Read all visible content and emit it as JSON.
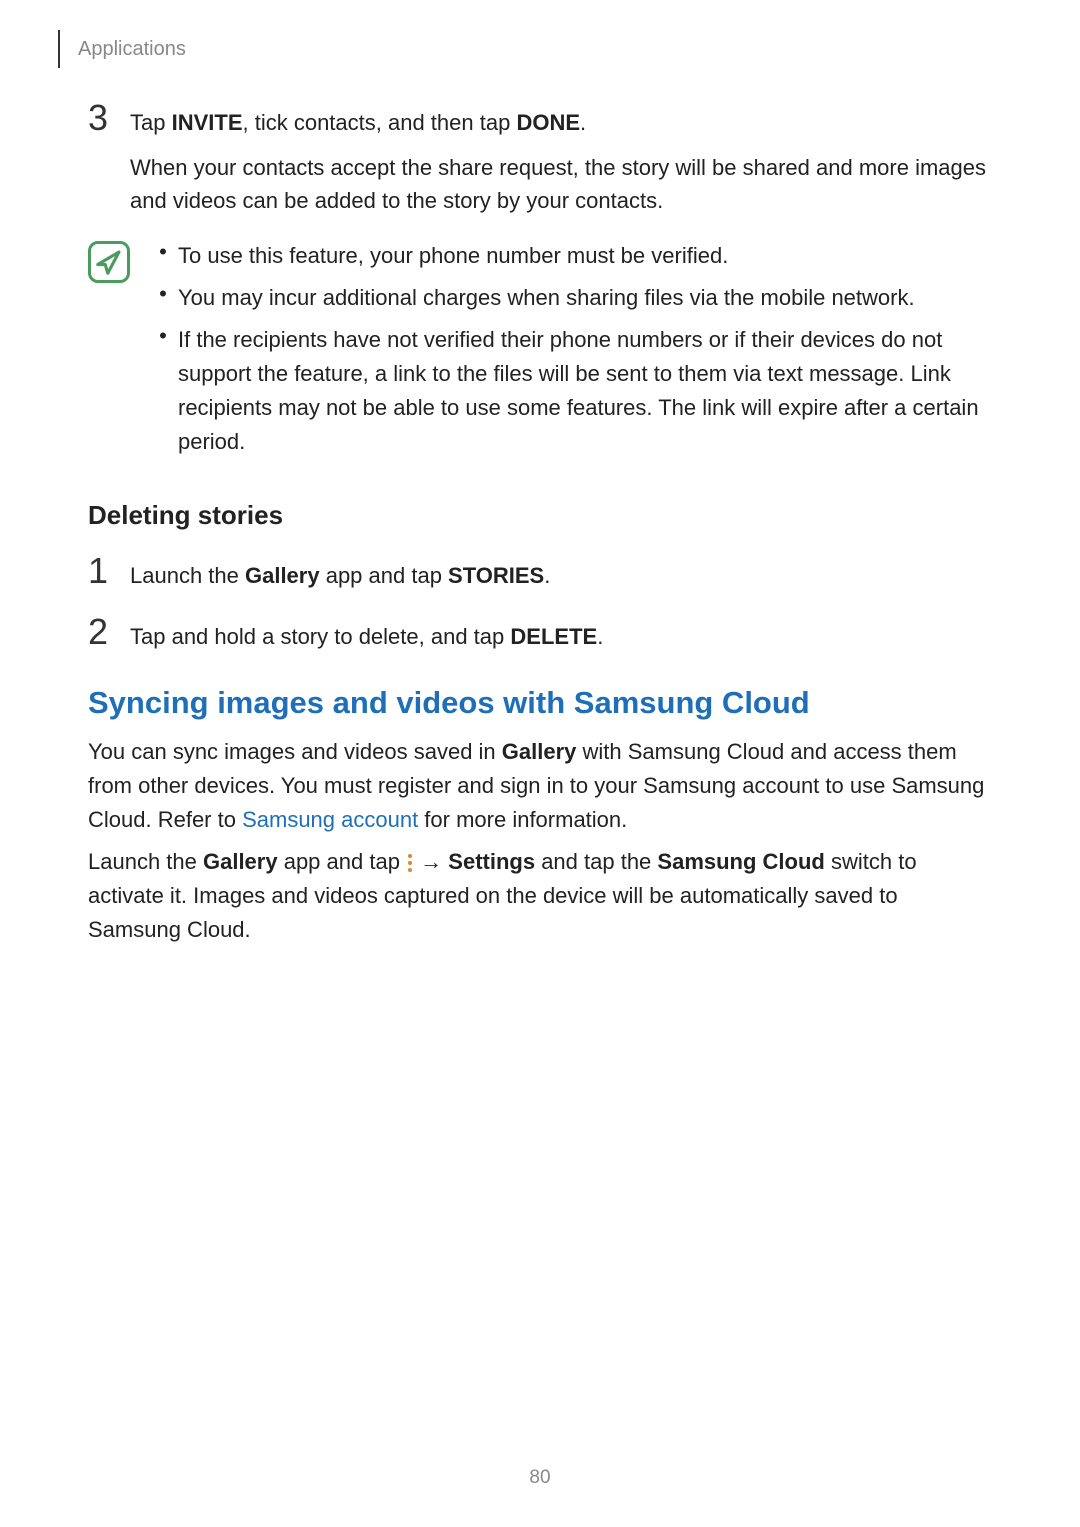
{
  "header": "Applications",
  "step3": {
    "num": "3",
    "prefix": "Tap ",
    "invite": "INVITE",
    "mid": ", tick contacts, and then tap ",
    "done": "DONE",
    "suffix": ".",
    "para": "When your contacts accept the share request, the story will be shared and more images and videos can be added to the story by your contacts."
  },
  "info": {
    "b1": "To use this feature, your phone number must be verified.",
    "b2": "You may incur additional charges when sharing files via the mobile network.",
    "b3": "If the recipients have not verified their phone numbers or if their devices do not support the feature, a link to the files will be sent to them via text message. Link recipients may not be able to use some features. The link will expire after a certain period."
  },
  "delete": {
    "heading": "Deleting stories",
    "s1": {
      "num": "1",
      "prefix": "Launch the ",
      "gallery": "Gallery",
      "mid": " app and tap ",
      "stories": "STORIES",
      "suffix": "."
    },
    "s2": {
      "num": "2",
      "prefix": "Tap and hold a story to delete, and tap ",
      "del": "DELETE",
      "suffix": "."
    }
  },
  "sync": {
    "heading": "Syncing images and videos with Samsung Cloud",
    "p1a": "You can sync images and videos saved in ",
    "p1b": "Gallery",
    "p1c": " with Samsung Cloud and access them from other devices. You must register and sign in to your Samsung account to use Samsung Cloud. Refer to ",
    "p1link": "Samsung account",
    "p1d": " for more information.",
    "p2a": "Launch the ",
    "p2b": "Gallery",
    "p2c": " app and tap ",
    "p2arrow": " → ",
    "p2d": "Settings",
    "p2e": " and tap the ",
    "p2f": "Samsung Cloud",
    "p2g": " switch to activate it. Images and videos captured on the device will be automatically saved to Samsung Cloud."
  },
  "page_number": "80"
}
